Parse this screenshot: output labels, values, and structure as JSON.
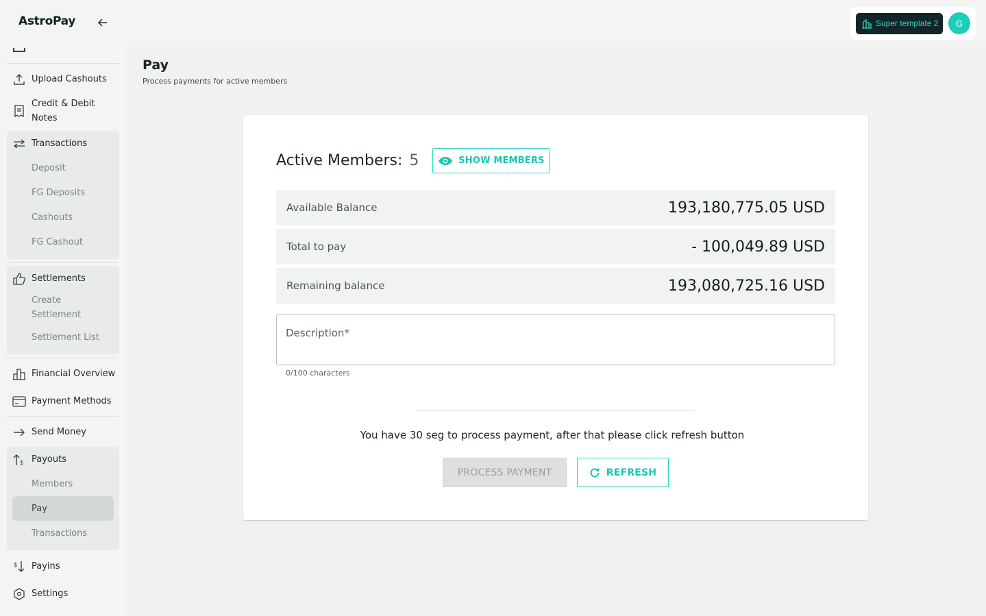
{
  "app": {
    "logo": "AstroPay",
    "account": {
      "template_name": "Super template 2",
      "avatar_initial": "G"
    }
  },
  "colors": {
    "accent": "#2ed3c3",
    "sidebar_bg": "#f3f4f3",
    "active_item_bg": "#d2d8d5"
  },
  "sidebar": {
    "upload_cashouts": "Upload Cashouts",
    "credit_debit_line1": "Credit & Debit",
    "credit_debit_line2": "Notes",
    "transactions": {
      "label": "Transactions",
      "items": [
        "Deposit",
        "FG Deposits",
        "Cashouts",
        "FG Cashout"
      ]
    },
    "settlements": {
      "label": "Settlements",
      "create_line1": "Create",
      "create_line2": "Settlement",
      "list": "Settlement List"
    },
    "financial_overview": "Financial Overview",
    "payment_methods": "Payment Methods",
    "send_money": "Send Money",
    "payouts": {
      "label": "Payouts",
      "items": [
        "Members",
        "Pay",
        "Transactions"
      ],
      "active": "Pay"
    },
    "payins": "Payins",
    "settings": "Settings"
  },
  "page": {
    "title": "Pay",
    "subtitle": "Process payments for active members"
  },
  "pay_card": {
    "active_members_label": "Active Members:",
    "active_members_count": "5",
    "show_members_label": "SHOW MEMBERS",
    "balances": [
      {
        "label": "Available Balance",
        "value": "193,180,775.05 USD"
      },
      {
        "label": "Total to pay",
        "value": "- 100,049.89 USD"
      },
      {
        "label": "Remaining balance",
        "value": "193,080,725.16 USD"
      }
    ],
    "description_placeholder": "Description*",
    "description_value": "",
    "char_counter": "0/100 characters",
    "notice": "You have 30 seg to process payment, after that please click refresh button",
    "process_payment_label": "PROCESS PAYMENT",
    "refresh_label": "REFRESH"
  }
}
